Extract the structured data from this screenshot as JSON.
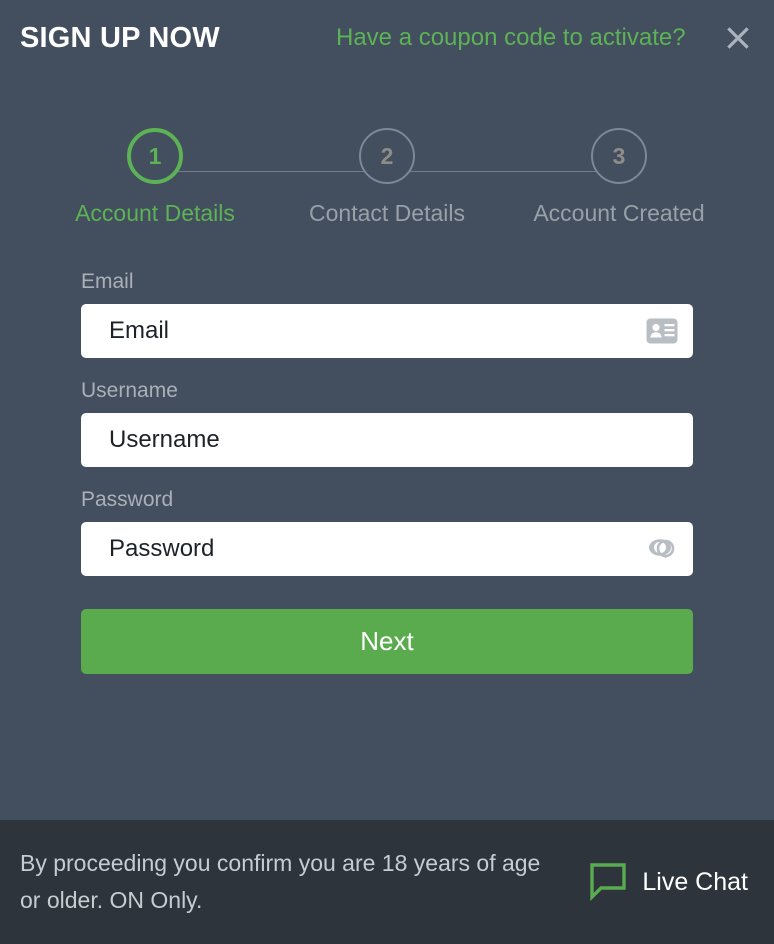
{
  "header": {
    "title": "SIGN UP NOW",
    "coupon_link": "Have a coupon code to activate?",
    "close_icon": "close-icon"
  },
  "stepper": {
    "steps": [
      {
        "number": "1",
        "label": "Account Details",
        "state": "active"
      },
      {
        "number": "2",
        "label": "Contact Details",
        "state": "inactive"
      },
      {
        "number": "3",
        "label": "Account Created",
        "state": "inactive"
      }
    ]
  },
  "form": {
    "fields": [
      {
        "label": "Email",
        "value": "",
        "placeholder": "Email",
        "icon": "contact-card-icon"
      },
      {
        "label": "Username",
        "value": "",
        "placeholder": "Username",
        "icon": ""
      },
      {
        "label": "Password",
        "value": "",
        "placeholder": "Password",
        "icon": "eye-reveal-password-icon"
      }
    ],
    "next_label": "Next"
  },
  "footer": {
    "disclaimer": "By proceeding you confirm you are 18 years of age or older. ON Only.",
    "live_chat_label": "Live Chat",
    "chat_icon": "speech-bubble-icon"
  },
  "colors": {
    "background": "#434f5e",
    "footer_background": "#2e343b",
    "accent_green": "#5cb255",
    "button_green": "#5aab4d",
    "label_gray": "#a9b0b8",
    "inactive_step": "#98a0a8",
    "input_background": "#ffffff",
    "input_text": "#1d2229"
  }
}
